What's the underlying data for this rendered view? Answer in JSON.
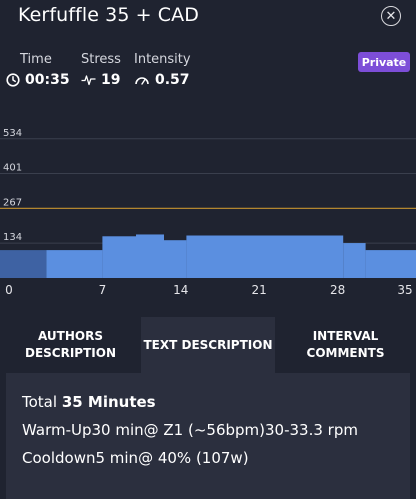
{
  "header": {
    "title": "Kerfuffle 35 + CAD",
    "badge": "Private"
  },
  "metrics": [
    {
      "label": "Time",
      "value": "00:35",
      "icon": "clock-icon"
    },
    {
      "label": "Stress",
      "value": "19",
      "icon": "pulse-icon"
    },
    {
      "label": "Intensity",
      "value": "0.57",
      "icon": "gauge-icon"
    }
  ],
  "chart_data": {
    "type": "area",
    "yticks": [
      "534",
      "401",
      "267",
      "134"
    ],
    "xticks": [
      "0",
      "7",
      "14",
      "21",
      "28",
      "35"
    ],
    "xlim": [
      0,
      35
    ],
    "ylim": [
      0,
      560
    ],
    "ftp_line": 267,
    "segments": [
      {
        "x0": 0,
        "x1": 2,
        "y": 107
      },
      {
        "x0": 2,
        "x1": 7,
        "y": 107
      },
      {
        "x0": 7,
        "x1": 10,
        "y": 160
      },
      {
        "x0": 10,
        "x1": 12.5,
        "y": 167
      },
      {
        "x0": 12.5,
        "x1": 14.5,
        "y": 145
      },
      {
        "x0": 14.5,
        "x1": 28.5,
        "y": 163
      },
      {
        "x0": 28.5,
        "x1": 30.5,
        "y": 134
      },
      {
        "x0": 30.5,
        "x1": 35,
        "y": 107
      }
    ],
    "colors": {
      "bar": "#5b8fe0",
      "warmup": "#3e62a3",
      "ftp": "#b2862f",
      "grid": "#3a3f4d"
    }
  },
  "tabs": [
    {
      "label_line1": "AUTHORS",
      "label_line2": "DESCRIPTION"
    },
    {
      "label_line1": "TEXT DESCRIPTION",
      "label_line2": ""
    },
    {
      "label_line1": "INTERVAL",
      "label_line2": "COMMENTS"
    }
  ],
  "description": {
    "total_prefix": "Total ",
    "total_value": "35 Minutes",
    "line2": "Warm-Up30 min@ Z1 (~56bpm)30-33.3 rpm",
    "line3": "Cooldown5 min@ 40% (107w)"
  }
}
